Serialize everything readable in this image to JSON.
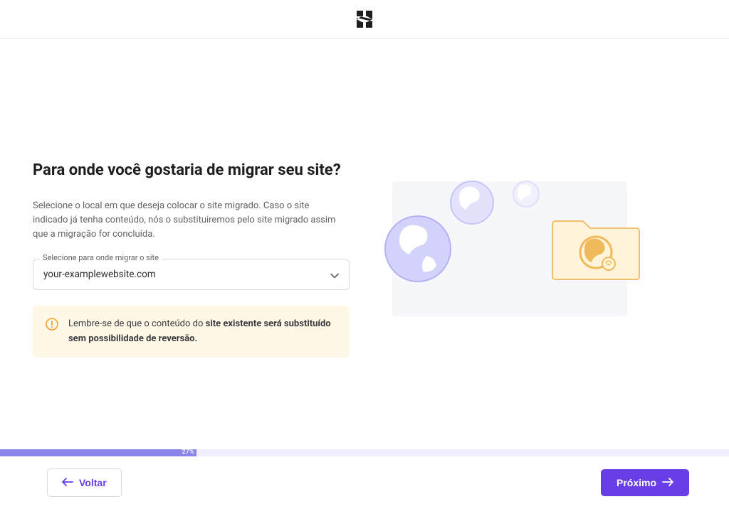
{
  "header": {
    "logo_name": "hostinger-logo"
  },
  "main": {
    "title": "Para onde você gostaria de migrar seu site?",
    "description": "Selecione o local em que deseja colocar o site migrado. Caso o site indicado já tenha conteúdo, nós o substituiremos pelo site migrado assim que a migração for concluída.",
    "select": {
      "label": "Selecione para onde migrar o site",
      "value": "your-examplewebsite.com"
    },
    "warning": {
      "prefix": "Lembre-se de que o conteúdo do ",
      "bold": "site existente será substituído sem possibilidade de reversão."
    }
  },
  "progress": {
    "percent": 27,
    "label": "27%"
  },
  "footer": {
    "back": "Voltar",
    "next": "Próximo"
  },
  "colors": {
    "primary": "#673de6",
    "warning_bg": "#fff8e6",
    "warning_icon": "#ff9c27"
  }
}
